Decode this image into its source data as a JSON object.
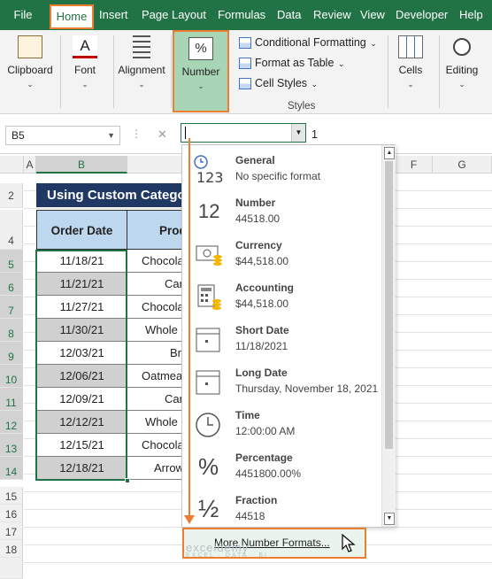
{
  "ribbon": {
    "tabs": [
      "File",
      "Home",
      "Insert",
      "Page Layout",
      "Formulas",
      "Data",
      "Review",
      "View",
      "Developer",
      "Help"
    ],
    "active_tab": "Home",
    "groups": {
      "clipboard": "Clipboard",
      "font": "Font",
      "alignment": "Alignment",
      "number": "Number",
      "cells": "Cells",
      "editing": "Editing"
    },
    "styles": {
      "conditional_formatting": "Conditional Formatting",
      "format_as_table": "Format as Table",
      "cell_styles": "Cell Styles",
      "label": "Styles"
    },
    "number_icon": "%"
  },
  "formula_bar": {
    "name_box": "B5",
    "cancel_symbol": "✕",
    "value": "1"
  },
  "grid": {
    "columns": {
      "a": "A",
      "b": "B",
      "f": "F",
      "g": "G"
    },
    "rows": [
      "2",
      "4",
      "5",
      "6",
      "7",
      "8",
      "9",
      "10",
      "11",
      "12",
      "13",
      "14",
      "15",
      "16",
      "17",
      "18"
    ],
    "title": "Using Custom Category",
    "headers": {
      "order_date": "Order Date",
      "product": "Product"
    },
    "order_dates": [
      "11/18/21",
      "11/21/21",
      "11/27/21",
      "11/30/21",
      "12/03/21",
      "12/06/21",
      "12/09/21",
      "12/12/21",
      "12/15/21",
      "12/18/21"
    ],
    "products": [
      "Chocolate",
      "Carrot",
      "Chocolate",
      "Whole",
      "Bran",
      "Oatmeal",
      "Carrot",
      "Whole",
      "Chocolate",
      "Arrowroot"
    ]
  },
  "number_format_dropdown": {
    "items": [
      {
        "name": "General",
        "sample": "No specific format",
        "icon": "clock-123-icon",
        "glyph": "123"
      },
      {
        "name": "Number",
        "sample": "44518.00",
        "icon": "number-12-icon",
        "glyph": "12"
      },
      {
        "name": "Currency",
        "sample": "$44,518.00",
        "icon": "currency-icon",
        "glyph": ""
      },
      {
        "name": "Accounting",
        "sample": "$44,518.00",
        "icon": "accounting-icon",
        "glyph": ""
      },
      {
        "name": "Short Date",
        "sample": "11/18/2021",
        "icon": "calendar-icon",
        "glyph": ""
      },
      {
        "name": "Long Date",
        "sample": "Thursday, November 18, 2021",
        "icon": "calendar-icon",
        "glyph": ""
      },
      {
        "name": "Time",
        "sample": "12:00:00 AM",
        "icon": "clock-icon",
        "glyph": ""
      },
      {
        "name": "Percentage",
        "sample": "4451800.00%",
        "icon": "percent-icon",
        "glyph": "%"
      },
      {
        "name": "Fraction",
        "sample": "44518",
        "icon": "fraction-icon",
        "glyph": "½"
      }
    ],
    "more_formats": "More Number Formats..."
  },
  "watermark": {
    "brand": "exceldemy",
    "tagline": "EXCEL · DATA · BI"
  },
  "colors": {
    "excel_green": "#217346",
    "highlight": "#ed7d31",
    "title_bg": "#1f3864",
    "header_bg": "#bdd7ee"
  }
}
